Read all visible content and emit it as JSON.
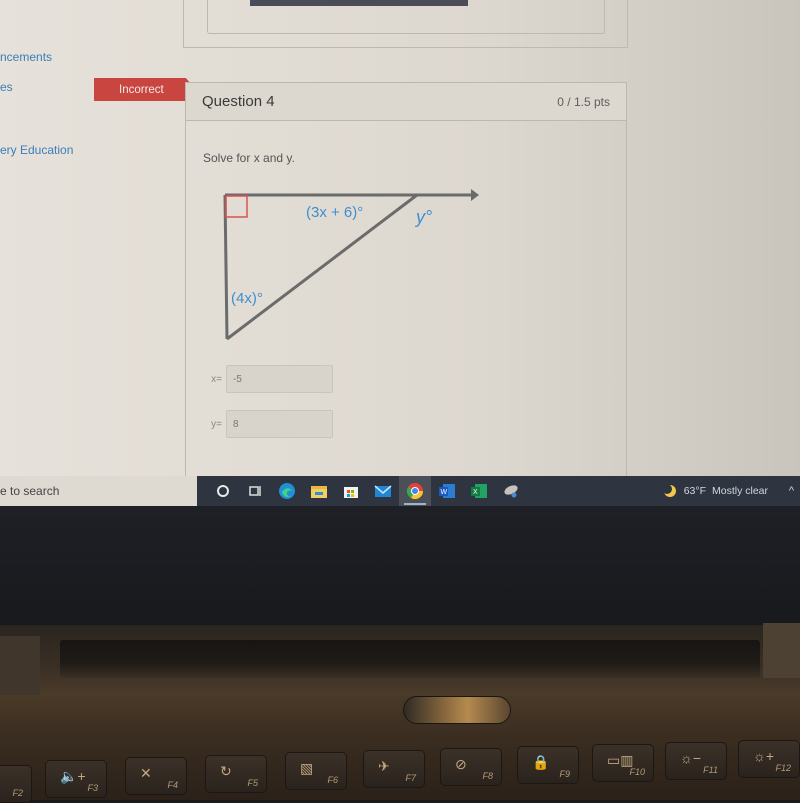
{
  "sidebar": {
    "items": [
      {
        "label": "ncements",
        "full": "Announcements"
      },
      {
        "label": "es"
      },
      {
        "label": "ery Education"
      }
    ]
  },
  "question": {
    "status_badge": "Incorrect",
    "title": "Question 4",
    "points": "0 / 1.5 pts",
    "prompt": "Solve for x and y.",
    "diagram": {
      "angle_top": "(3x + 6)°",
      "angle_exterior": "y°",
      "angle_bottom": "(4x)°",
      "right_angle_marker_color": "#d9534f",
      "label_color": "#3d8fd1"
    },
    "answers": [
      {
        "label": "x=",
        "value": "-5"
      },
      {
        "label": "y=",
        "value": "8"
      }
    ]
  },
  "taskbar": {
    "search_placeholder": "e to search",
    "apps": [
      {
        "name": "cortana",
        "icon": "circle-icon"
      },
      {
        "name": "task-view",
        "icon": "task-view-icon"
      },
      {
        "name": "edge",
        "icon": "edge-icon"
      },
      {
        "name": "file-explorer",
        "icon": "folder-icon"
      },
      {
        "name": "store",
        "icon": "store-icon"
      },
      {
        "name": "mail",
        "icon": "mail-icon"
      },
      {
        "name": "chrome",
        "icon": "chrome-icon",
        "active": true
      },
      {
        "name": "word",
        "icon": "word-icon"
      },
      {
        "name": "excel",
        "icon": "excel-icon"
      },
      {
        "name": "app",
        "icon": "satellite-icon"
      }
    ],
    "weather": {
      "temp": "63°F",
      "condition": "Mostly clear"
    },
    "tray_chevron": "^"
  },
  "keyboard": {
    "keys": [
      {
        "fn": "F2",
        "glyph": ""
      },
      {
        "fn": "F3",
        "glyph": "🔈+"
      },
      {
        "fn": "F4",
        "glyph": "✕"
      },
      {
        "fn": "F5",
        "glyph": "↻"
      },
      {
        "fn": "F6",
        "glyph": "▧"
      },
      {
        "fn": "F7",
        "glyph": "✈"
      },
      {
        "fn": "F8",
        "glyph": "⊘"
      },
      {
        "fn": "F9",
        "glyph": "🔒"
      },
      {
        "fn": "F10",
        "glyph": "▭▥"
      },
      {
        "fn": "F11",
        "glyph": "☼−"
      },
      {
        "fn": "F12",
        "glyph": "☼+"
      }
    ]
  }
}
